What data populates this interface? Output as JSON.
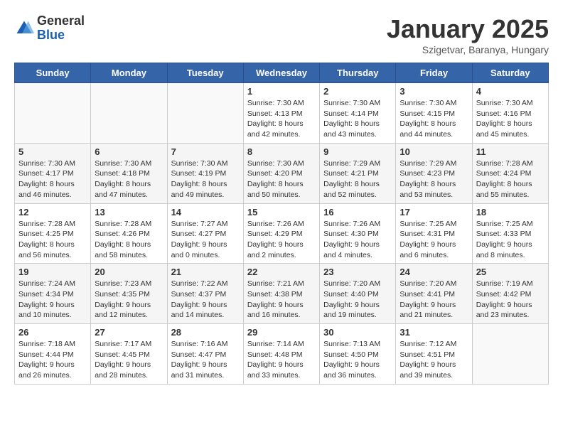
{
  "header": {
    "logo": {
      "line1": "General",
      "line2": "Blue"
    },
    "title": "January 2025",
    "location": "Szigetvar, Baranya, Hungary"
  },
  "weekdays": [
    "Sunday",
    "Monday",
    "Tuesday",
    "Wednesday",
    "Thursday",
    "Friday",
    "Saturday"
  ],
  "weeks": [
    [
      {
        "day": "",
        "info": ""
      },
      {
        "day": "",
        "info": ""
      },
      {
        "day": "",
        "info": ""
      },
      {
        "day": "1",
        "info": "Sunrise: 7:30 AM\nSunset: 4:13 PM\nDaylight: 8 hours\nand 42 minutes."
      },
      {
        "day": "2",
        "info": "Sunrise: 7:30 AM\nSunset: 4:14 PM\nDaylight: 8 hours\nand 43 minutes."
      },
      {
        "day": "3",
        "info": "Sunrise: 7:30 AM\nSunset: 4:15 PM\nDaylight: 8 hours\nand 44 minutes."
      },
      {
        "day": "4",
        "info": "Sunrise: 7:30 AM\nSunset: 4:16 PM\nDaylight: 8 hours\nand 45 minutes."
      }
    ],
    [
      {
        "day": "5",
        "info": "Sunrise: 7:30 AM\nSunset: 4:17 PM\nDaylight: 8 hours\nand 46 minutes."
      },
      {
        "day": "6",
        "info": "Sunrise: 7:30 AM\nSunset: 4:18 PM\nDaylight: 8 hours\nand 47 minutes."
      },
      {
        "day": "7",
        "info": "Sunrise: 7:30 AM\nSunset: 4:19 PM\nDaylight: 8 hours\nand 49 minutes."
      },
      {
        "day": "8",
        "info": "Sunrise: 7:30 AM\nSunset: 4:20 PM\nDaylight: 8 hours\nand 50 minutes."
      },
      {
        "day": "9",
        "info": "Sunrise: 7:29 AM\nSunset: 4:21 PM\nDaylight: 8 hours\nand 52 minutes."
      },
      {
        "day": "10",
        "info": "Sunrise: 7:29 AM\nSunset: 4:23 PM\nDaylight: 8 hours\nand 53 minutes."
      },
      {
        "day": "11",
        "info": "Sunrise: 7:28 AM\nSunset: 4:24 PM\nDaylight: 8 hours\nand 55 minutes."
      }
    ],
    [
      {
        "day": "12",
        "info": "Sunrise: 7:28 AM\nSunset: 4:25 PM\nDaylight: 8 hours\nand 56 minutes."
      },
      {
        "day": "13",
        "info": "Sunrise: 7:28 AM\nSunset: 4:26 PM\nDaylight: 8 hours\nand 58 minutes."
      },
      {
        "day": "14",
        "info": "Sunrise: 7:27 AM\nSunset: 4:27 PM\nDaylight: 9 hours\nand 0 minutes."
      },
      {
        "day": "15",
        "info": "Sunrise: 7:26 AM\nSunset: 4:29 PM\nDaylight: 9 hours\nand 2 minutes."
      },
      {
        "day": "16",
        "info": "Sunrise: 7:26 AM\nSunset: 4:30 PM\nDaylight: 9 hours\nand 4 minutes."
      },
      {
        "day": "17",
        "info": "Sunrise: 7:25 AM\nSunset: 4:31 PM\nDaylight: 9 hours\nand 6 minutes."
      },
      {
        "day": "18",
        "info": "Sunrise: 7:25 AM\nSunset: 4:33 PM\nDaylight: 9 hours\nand 8 minutes."
      }
    ],
    [
      {
        "day": "19",
        "info": "Sunrise: 7:24 AM\nSunset: 4:34 PM\nDaylight: 9 hours\nand 10 minutes."
      },
      {
        "day": "20",
        "info": "Sunrise: 7:23 AM\nSunset: 4:35 PM\nDaylight: 9 hours\nand 12 minutes."
      },
      {
        "day": "21",
        "info": "Sunrise: 7:22 AM\nSunset: 4:37 PM\nDaylight: 9 hours\nand 14 minutes."
      },
      {
        "day": "22",
        "info": "Sunrise: 7:21 AM\nSunset: 4:38 PM\nDaylight: 9 hours\nand 16 minutes."
      },
      {
        "day": "23",
        "info": "Sunrise: 7:20 AM\nSunset: 4:40 PM\nDaylight: 9 hours\nand 19 minutes."
      },
      {
        "day": "24",
        "info": "Sunrise: 7:20 AM\nSunset: 4:41 PM\nDaylight: 9 hours\nand 21 minutes."
      },
      {
        "day": "25",
        "info": "Sunrise: 7:19 AM\nSunset: 4:42 PM\nDaylight: 9 hours\nand 23 minutes."
      }
    ],
    [
      {
        "day": "26",
        "info": "Sunrise: 7:18 AM\nSunset: 4:44 PM\nDaylight: 9 hours\nand 26 minutes."
      },
      {
        "day": "27",
        "info": "Sunrise: 7:17 AM\nSunset: 4:45 PM\nDaylight: 9 hours\nand 28 minutes."
      },
      {
        "day": "28",
        "info": "Sunrise: 7:16 AM\nSunset: 4:47 PM\nDaylight: 9 hours\nand 31 minutes."
      },
      {
        "day": "29",
        "info": "Sunrise: 7:14 AM\nSunset: 4:48 PM\nDaylight: 9 hours\nand 33 minutes."
      },
      {
        "day": "30",
        "info": "Sunrise: 7:13 AM\nSunset: 4:50 PM\nDaylight: 9 hours\nand 36 minutes."
      },
      {
        "day": "31",
        "info": "Sunrise: 7:12 AM\nSunset: 4:51 PM\nDaylight: 9 hours\nand 39 minutes."
      },
      {
        "day": "",
        "info": ""
      }
    ]
  ]
}
